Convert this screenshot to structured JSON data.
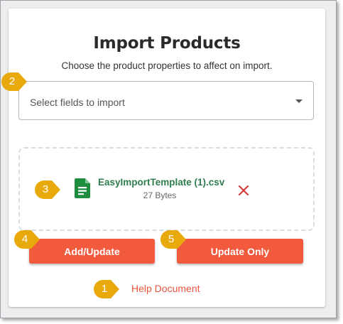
{
  "dialog": {
    "title": "Import Products",
    "subtitle": "Choose the product properties to affect on import.",
    "select": {
      "placeholder": "Select fields to import"
    },
    "file": {
      "name": "EasyImportTemplate (1).csv",
      "size": "27 Bytes"
    },
    "buttons": {
      "add_update": "Add/Update",
      "update_only": "Update Only"
    },
    "help_link": "Help Document"
  },
  "callouts": [
    "1",
    "2",
    "3",
    "4",
    "5"
  ],
  "colors": {
    "accent": "#f25a3e",
    "file_green": "#1e8e3e",
    "remove_red": "#d93a3a",
    "callout_gold": "#e8a90c"
  },
  "icons": {
    "file": "spreadsheet-file-icon",
    "remove": "close-icon",
    "select": "chevron-down-icon"
  }
}
